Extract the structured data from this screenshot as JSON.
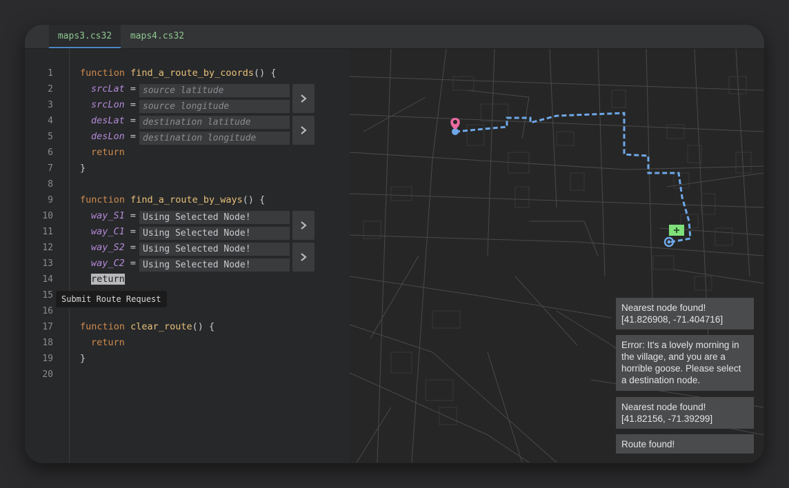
{
  "tabs": [
    {
      "label": "maps3.cs32",
      "active": true
    },
    {
      "label": "maps4.cs32",
      "active": false
    }
  ],
  "line_numbers": [
    "1",
    "2",
    "3",
    "4",
    "5",
    "6",
    "7",
    "8",
    "9",
    "10",
    "11",
    "12",
    "13",
    "14",
    "15",
    "16",
    "17",
    "18",
    "19",
    "20"
  ],
  "code": {
    "func1": {
      "keyword": "function",
      "name": "find_a_route_by_coords",
      "sig": "() {"
    },
    "func2": {
      "keyword": "function",
      "name": "find_a_route_by_ways",
      "sig": "() {"
    },
    "func3": {
      "keyword": "function",
      "name": "clear_route",
      "sig": "() {"
    },
    "return_kw": "return",
    "close_brace": "}",
    "equals": "=",
    "coords_fields": [
      {
        "var": "srcLat",
        "placeholder": "source latitude"
      },
      {
        "var": "srcLon",
        "placeholder": "source longitude"
      },
      {
        "var": "desLat",
        "placeholder": "destination latitude"
      },
      {
        "var": "desLon",
        "placeholder": "destination longitude"
      }
    ],
    "ways_fields": [
      {
        "var": "way_S1",
        "value": "Using Selected Node!"
      },
      {
        "var": "way_C1",
        "value": "Using Selected Node!"
      },
      {
        "var": "way_S2",
        "value": "Using Selected Node!"
      },
      {
        "var": "way_C2",
        "value": "Using Selected Node!"
      }
    ]
  },
  "tooltip": "Submit Route Request",
  "notifications": [
    "Nearest node found!\n[41.826908, -71.404716]",
    "Error: It's a lovely morning in the village, and you are a horrible goose. Please select a destination node.",
    "Nearest node found!\n[41.82156, -71.39299]",
    "Route found!"
  ],
  "colors": {
    "route": "#6fa8e8",
    "source_pin": "#e86aa0",
    "dest_flag": "#7fe07a",
    "node": "#6fa8e8"
  },
  "icons": {
    "submit": "chevron-right-icon",
    "source_marker": "location-pin-icon",
    "destination_marker": "flag-icon"
  }
}
